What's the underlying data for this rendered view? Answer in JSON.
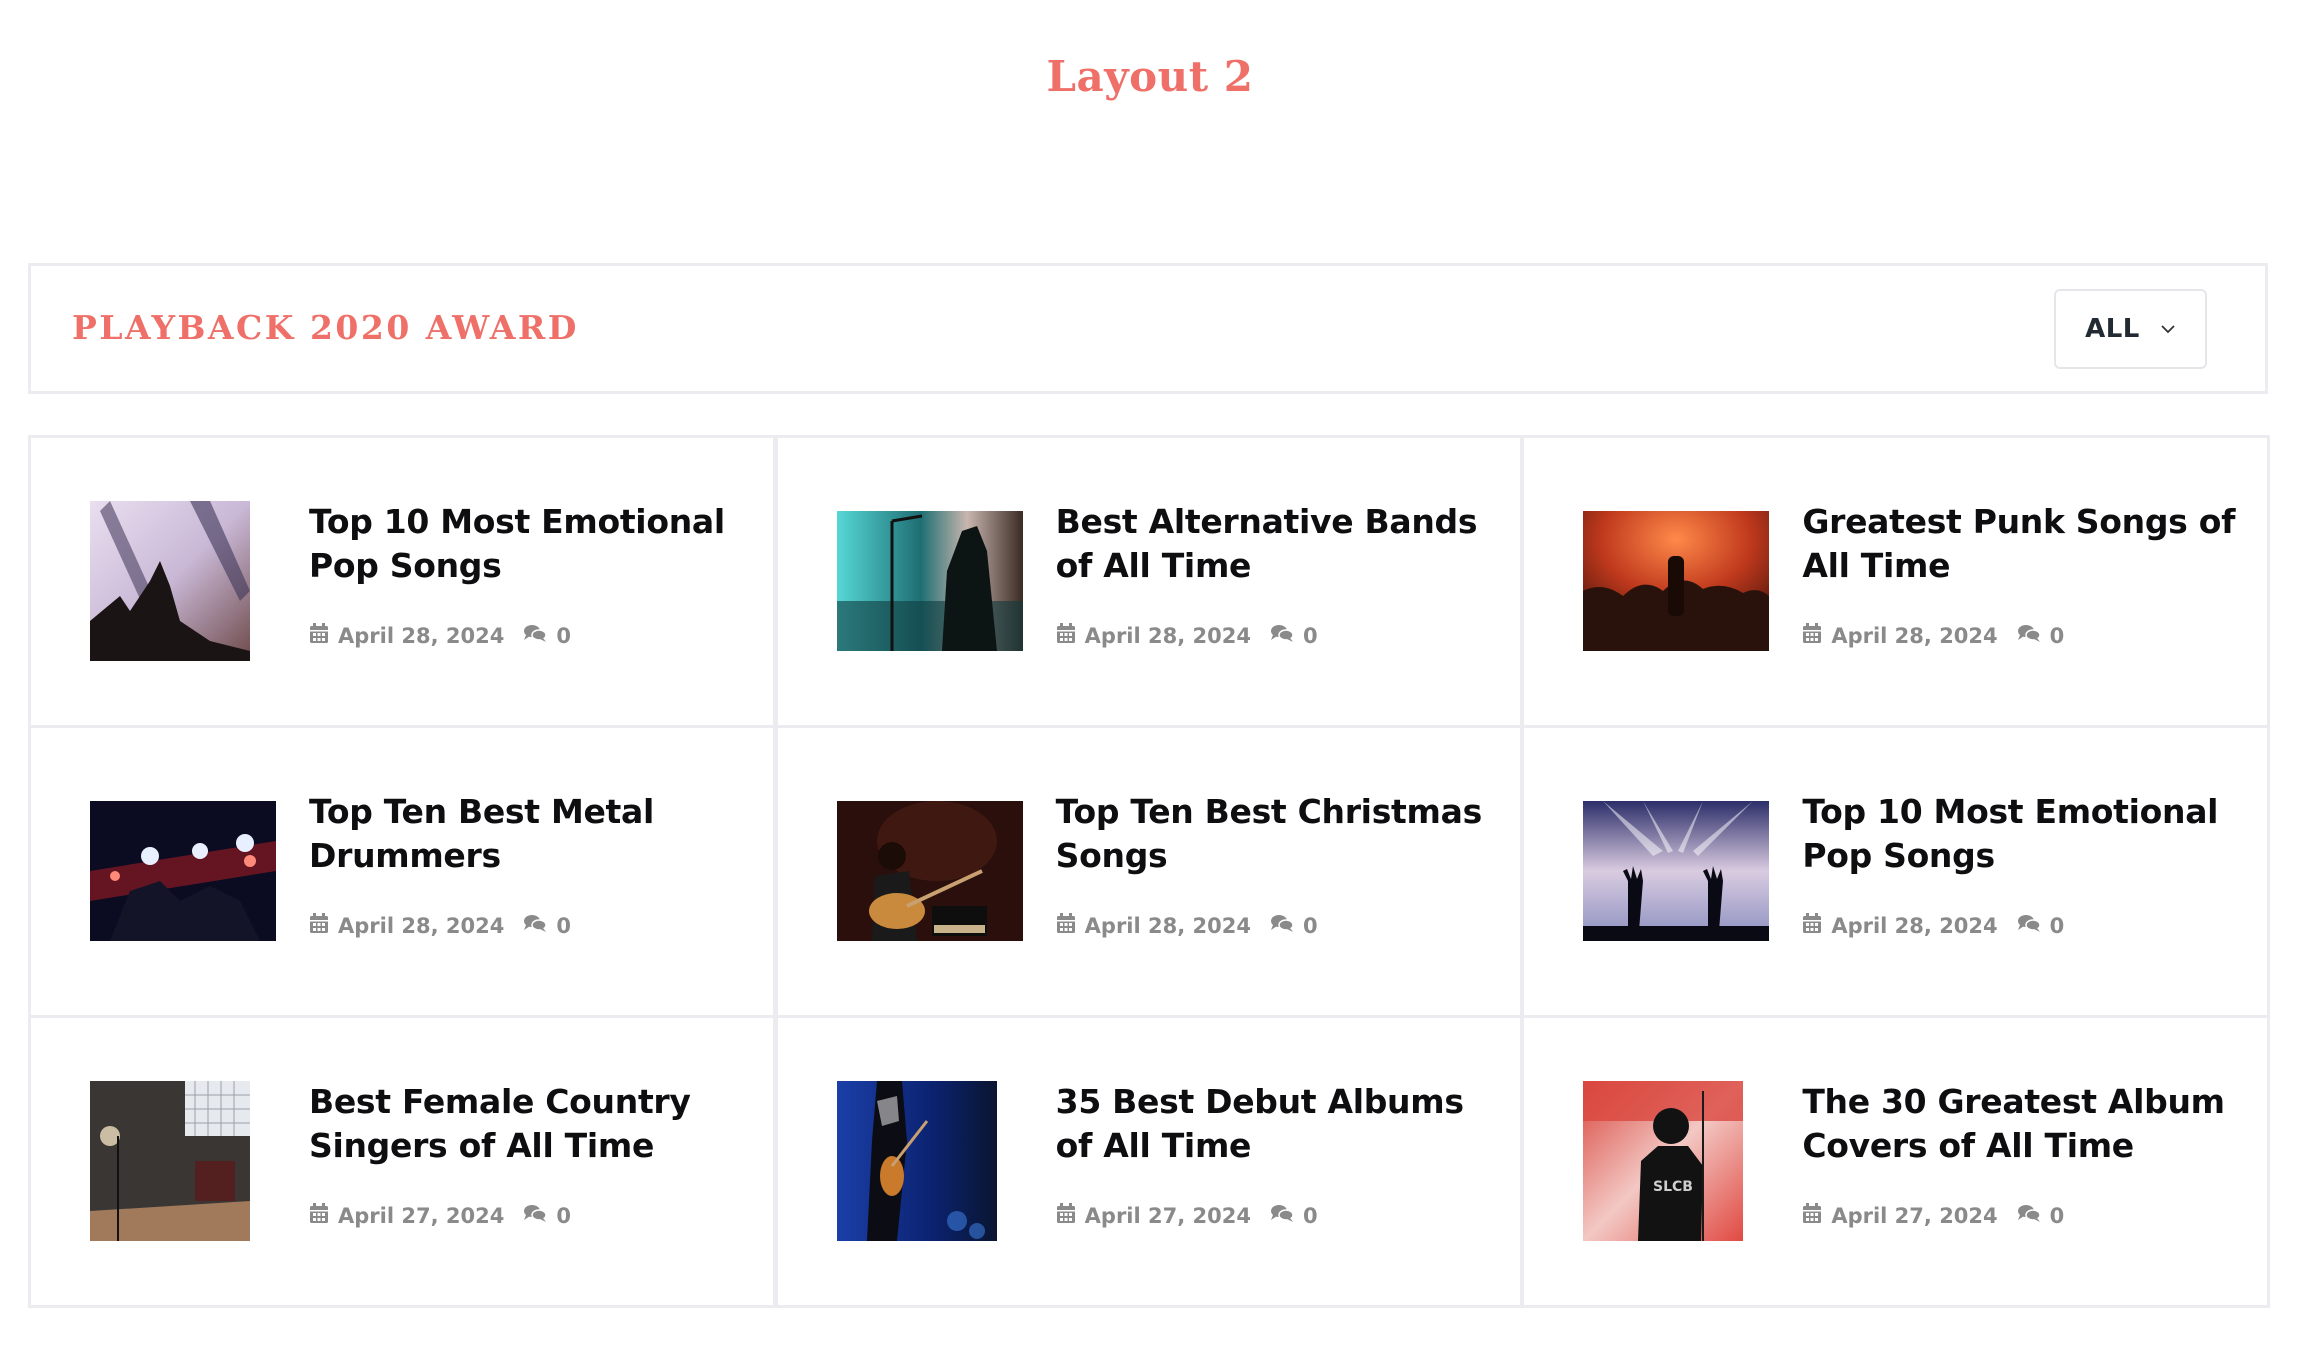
{
  "page": {
    "title": "Layout 2"
  },
  "header": {
    "section_title": "PLAYBACK 2020 AWARD",
    "filter": {
      "selected": "ALL",
      "icon": "chevron-down-icon"
    }
  },
  "colors": {
    "accent": "#ee7068",
    "border": "#ebebf0",
    "meta": "#8a8a8a",
    "title": "#0e0e10"
  },
  "posts": [
    {
      "title": "Top 10 Most Emotional Pop Songs",
      "date": "April 28, 2024",
      "comments": "0",
      "thumb": "concert-smoke-hands",
      "shape": "square"
    },
    {
      "title": "Best Alternative Bands of All Time",
      "date": "April 28, 2024",
      "comments": "0",
      "thumb": "singer-mic-teal",
      "shape": "wide"
    },
    {
      "title": "Greatest Punk Songs of All Time",
      "date": "April 28, 2024",
      "comments": "0",
      "thumb": "orange-stage-crowd",
      "shape": "wide"
    },
    {
      "title": "Top Ten Best Metal Drummers",
      "date": "April 28, 2024",
      "comments": "0",
      "thumb": "dark-stage-lights",
      "shape": "wide"
    },
    {
      "title": "Top Ten Best Christmas Songs",
      "date": "April 28, 2024",
      "comments": "0",
      "thumb": "guitarist-amp",
      "shape": "wide"
    },
    {
      "title": "Top 10 Most Emotional Pop Songs",
      "date": "April 28, 2024",
      "comments": "0",
      "thumb": "raised-hands-lights",
      "shape": "wide"
    },
    {
      "title": "Best Female Country Singers of All Time",
      "date": "April 27, 2024",
      "comments": "0",
      "thumb": "studio-room",
      "shape": "square"
    },
    {
      "title": "35 Best Debut Albums of All Time",
      "date": "April 27, 2024",
      "comments": "0",
      "thumb": "guitarist-blue",
      "shape": "square"
    },
    {
      "title": "The 30 Greatest Album Covers of All Time",
      "date": "April 27, 2024",
      "comments": "0",
      "thumb": "singer-red-wall",
      "shape": "square"
    }
  ]
}
